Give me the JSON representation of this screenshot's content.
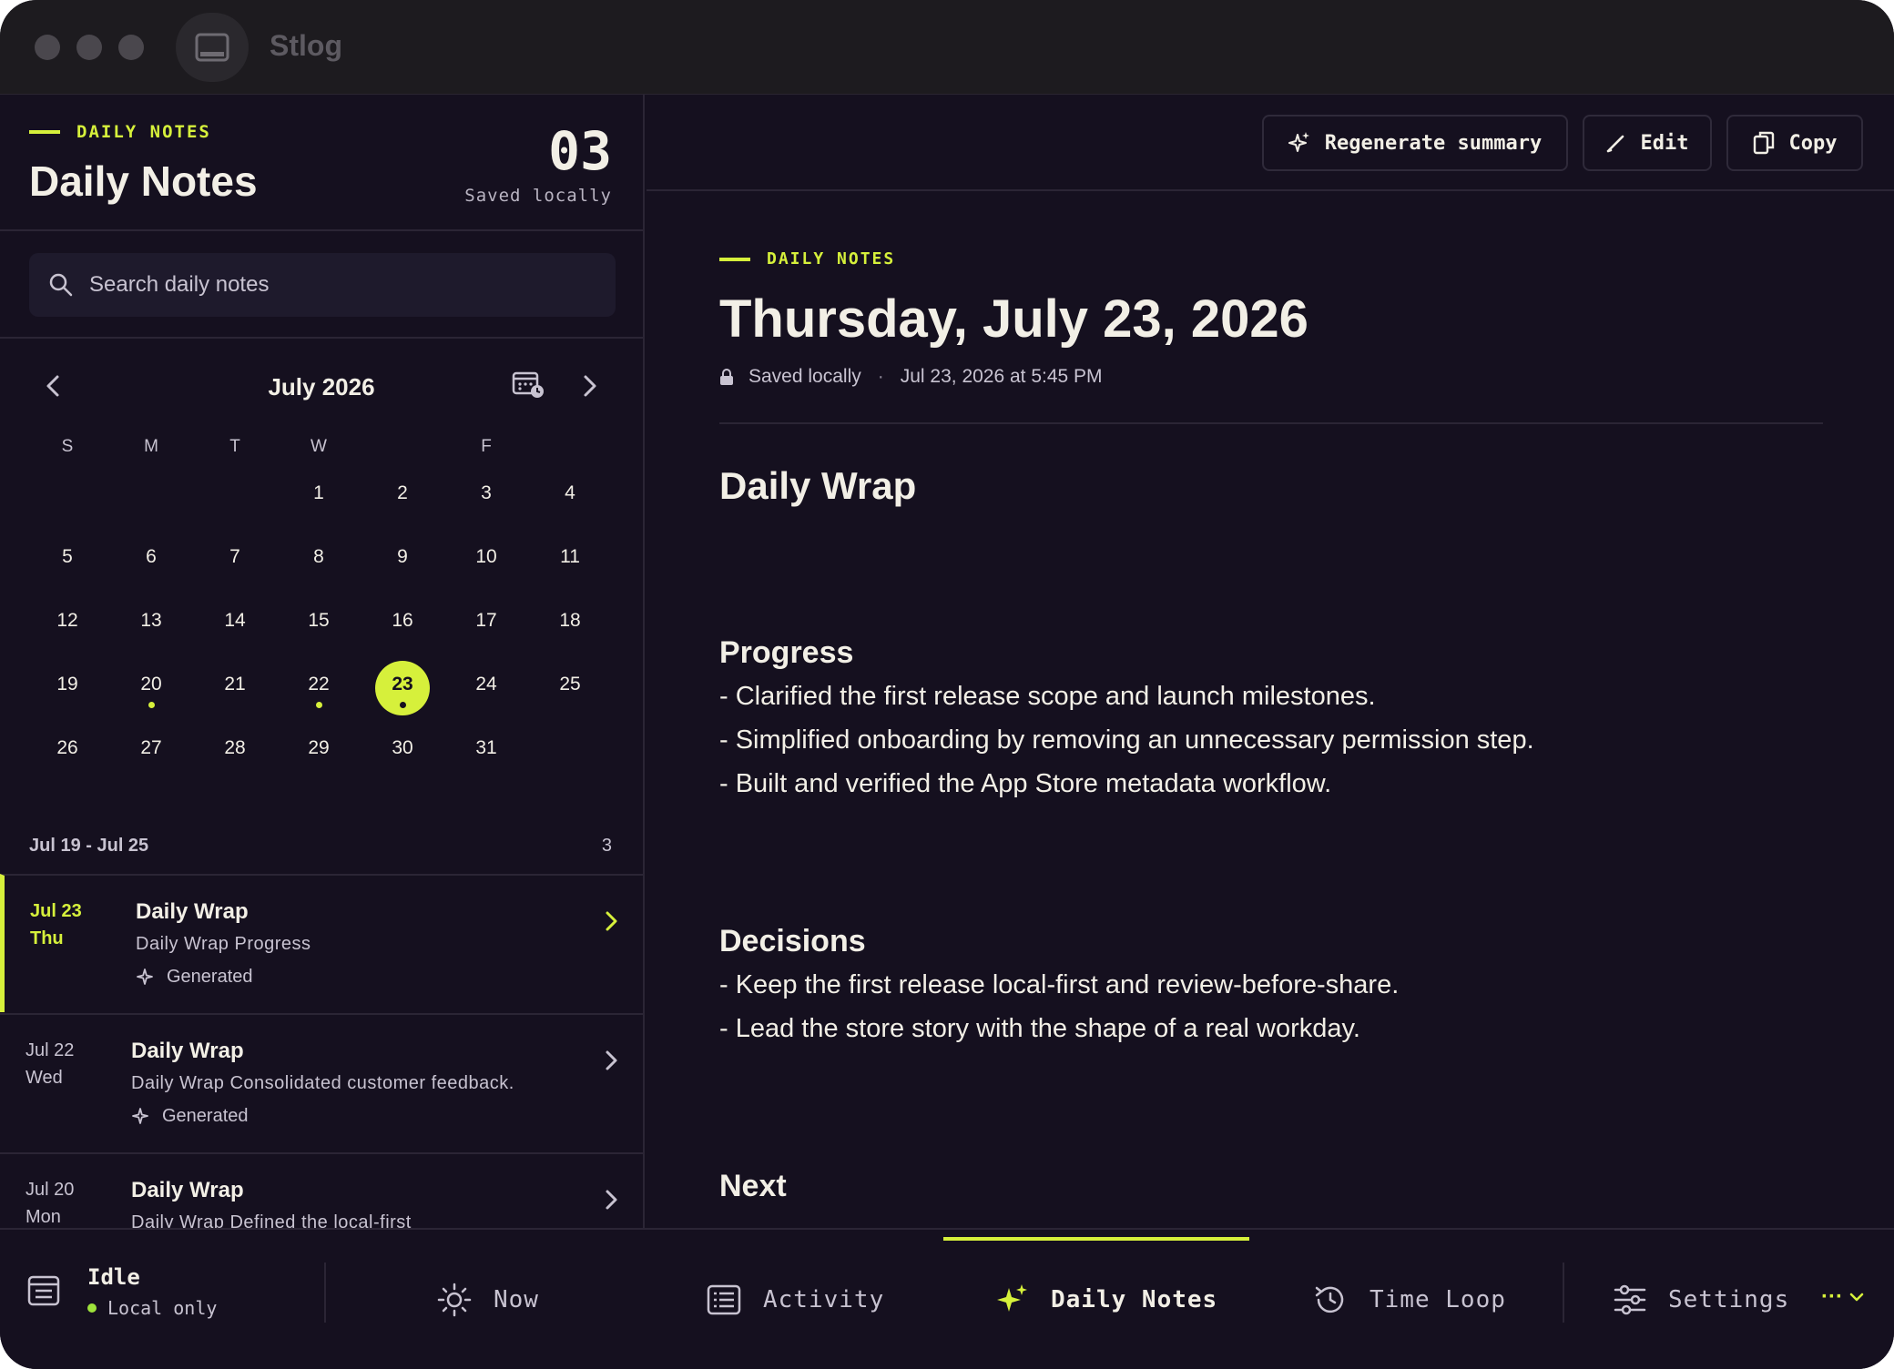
{
  "window": {
    "app_title": "Stlog"
  },
  "sidebar": {
    "eyebrow": "DAILY NOTES",
    "title": "Daily Notes",
    "count": "03",
    "saved": "Saved locally",
    "search_placeholder": "Search daily notes",
    "calendar": {
      "month": "July 2026",
      "weekdays": [
        "S",
        "M",
        "T",
        "W",
        "",
        "F",
        ""
      ],
      "weeks": [
        [
          "",
          "",
          "",
          "1",
          "2",
          "3",
          "4"
        ],
        [
          "5",
          "6",
          "7",
          "8",
          "9",
          "10",
          "11"
        ],
        [
          "12",
          "13",
          "14",
          "15",
          "16",
          "17",
          "18"
        ],
        [
          "19",
          "20",
          "21",
          "22",
          "23",
          "24",
          "25"
        ],
        [
          "26",
          "27",
          "28",
          "29",
          "30",
          "31",
          ""
        ]
      ],
      "selected_day": "23",
      "days_with_notes": [
        "20",
        "22",
        "23"
      ]
    },
    "week_range": "Jul 19 - Jul 25",
    "week_count": "3",
    "notes": [
      {
        "date": "Jul 23",
        "weekday": "Thu",
        "title": "Daily Wrap",
        "subtitle": "Daily Wrap Progress",
        "status": "Generated"
      },
      {
        "date": "Jul 22",
        "weekday": "Wed",
        "title": "Daily Wrap",
        "subtitle": "Daily Wrap Consolidated customer feedback.",
        "status": "Generated"
      },
      {
        "date": "Jul 20",
        "weekday": "Mon",
        "title": "Daily Wrap",
        "subtitle": "Daily Wrap Defined the local-first",
        "status": ""
      }
    ]
  },
  "toolbar": {
    "regenerate_label": "Regenerate summary",
    "edit_label": "Edit",
    "copy_label": "Copy"
  },
  "document": {
    "eyebrow": "DAILY NOTES",
    "title": "Thursday, July 23, 2026",
    "saved": "Saved locally",
    "separator": "·",
    "timestamp": "Jul 23, 2026 at 5:45 PM",
    "heading": "Daily Wrap",
    "sections": [
      {
        "heading": "Progress",
        "lines": [
          "- Clarified the first release scope and launch milestones.",
          "- Simplified onboarding by removing an unnecessary permission step.",
          "- Built and verified the App Store metadata workflow."
        ]
      },
      {
        "heading": "Decisions",
        "lines": [
          "- Keep the first release local-first and review-before-share.",
          "- Lead the store story with the shape of a real workday."
        ]
      },
      {
        "heading": "Next",
        "lines": []
      }
    ]
  },
  "tabbar": {
    "status_title": "Idle",
    "status_sub": "Local only",
    "tabs": [
      {
        "label": "Now",
        "icon": "sun-icon"
      },
      {
        "label": "Activity",
        "icon": "list-icon"
      },
      {
        "label": "Daily Notes",
        "icon": "sparkle-icon",
        "active": true
      },
      {
        "label": "Time Loop",
        "icon": "history-icon"
      },
      {
        "label": "Settings",
        "icon": "sliders-icon"
      }
    ],
    "more_label": "···"
  },
  "colors": {
    "accent": "#d6f03b",
    "background": "#15101f",
    "status_green": "#9ee23b"
  }
}
